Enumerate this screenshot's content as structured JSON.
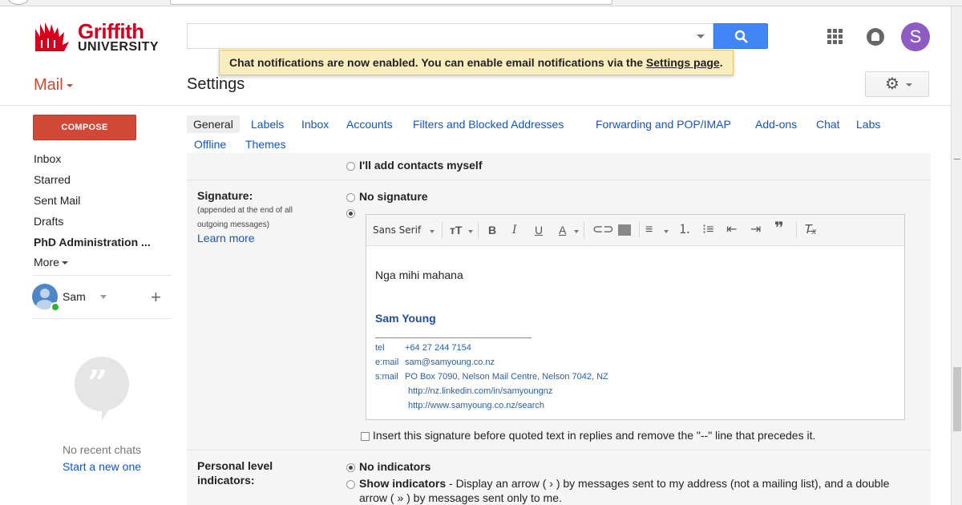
{
  "brand": {
    "line1": "Griffith",
    "line2": "UNIVERSITY"
  },
  "header": {
    "search_placeholder": "",
    "avatar_letter": "S",
    "toast_text": "Chat notifications are now enabled. You can enable email notifications via the ",
    "toast_link": "Settings page",
    "toast_end": "."
  },
  "mail_label": "Mail",
  "page_title": "Settings",
  "nav": {
    "compose": "COMPOSE",
    "items": [
      "Inbox",
      "Starred",
      "Sent Mail",
      "Drafts",
      "PhD Administration ..."
    ],
    "more": "More",
    "user_name": "Sam",
    "no_chats": "No recent chats",
    "start_chat": "Start a new one"
  },
  "tabs": [
    "General",
    "Labels",
    "Inbox",
    "Accounts",
    "Filters and Blocked Addresses",
    "Forwarding and POP/IMAP",
    "Add-ons",
    "Chat",
    "Labs",
    "Offline",
    "Themes"
  ],
  "contacts_option": "I'll add contacts myself",
  "signature": {
    "label": "Signature:",
    "note_1": "(appended at the end of all",
    "note_2": "outgoing messages)",
    "learn_more": "Learn more",
    "no_sig": "No signature",
    "font": "Sans Serif",
    "greeting": "Nga mihi mahana",
    "name": "Sam Young",
    "tel_label": "tel",
    "tel_value": "+64 27 244 7154",
    "email_label": "e:mail",
    "email_value": "sam@samyoung.co.nz",
    "smail_label": "s:mail",
    "smail_value": "PO Box 7090, Nelson Mail Centre, Nelson 7042, NZ",
    "link1": "http://nz.linkedin.com/in/samyoungnz",
    "link2": "http://www.samyoung.co.nz/search",
    "insert_before": "Insert this signature before quoted text in replies and remove the \"--\" line that precedes it."
  },
  "indicators": {
    "label_1": "Personal level",
    "label_2": "indicators:",
    "no_ind": "No indicators",
    "show_ind": "Show indicators",
    "show_desc_1": " - Display an arrow ( › ) by messages sent to my address (not a mailing list), and a double",
    "show_desc_2": "arrow ( » ) by messages sent only to me."
  },
  "colors": {
    "accent_red": "#d14836",
    "link_blue": "#1155cc",
    "search_blue": "#4285f4",
    "avatar_purple": "#8e5bc4",
    "toast_bg": "#f9edbe"
  },
  "icons": [
    "search-icon",
    "apps-icon",
    "notifications-icon",
    "gear-icon",
    "add-person-icon",
    "hangouts-quote-icon"
  ]
}
